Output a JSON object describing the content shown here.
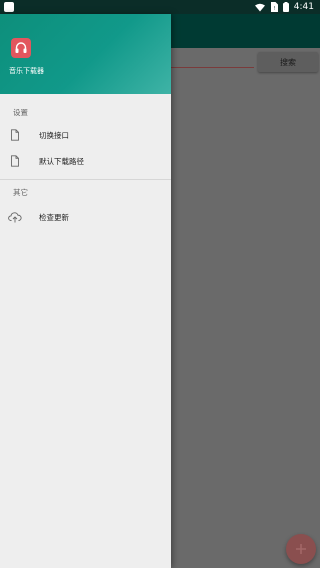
{
  "status_bar": {
    "time": "4:41"
  },
  "background": {
    "search_button_label": "搜索",
    "fab_icon": "plus-icon"
  },
  "drawer": {
    "header": {
      "app_name": "音乐下载器",
      "app_icon": "headphones-icon"
    },
    "sections": [
      {
        "title": "设置",
        "items": [
          {
            "label": "切换接口",
            "icon": "file-icon"
          },
          {
            "label": "默认下载路径",
            "icon": "file-icon"
          }
        ]
      },
      {
        "title": "其它",
        "items": [
          {
            "label": "检查更新",
            "icon": "cloud-upload-icon"
          }
        ]
      }
    ]
  },
  "colors": {
    "header_gradient_start": "#0d8f7b",
    "header_gradient_end": "#3fb3a6",
    "app_icon_bg": "#e2565e",
    "status_bar": "#0b2d28"
  }
}
